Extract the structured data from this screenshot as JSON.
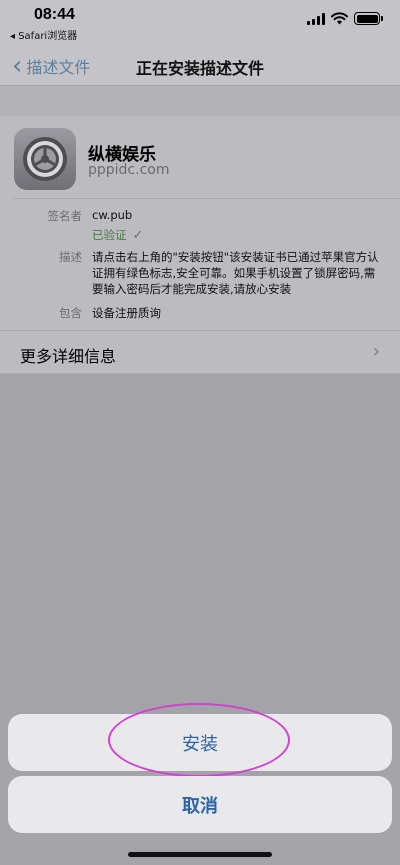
{
  "status_bar": {
    "time": "08:44",
    "back_app": "◂ Safari浏览器",
    "icons": [
      "signal-icon",
      "wifi-icon",
      "battery-icon"
    ]
  },
  "nav": {
    "back_label": "描述文件",
    "title": "正在安装描述文件"
  },
  "profile": {
    "icon": "gear-icon",
    "name": "纵横娱乐",
    "domain": "pppidc.com",
    "signer_label": "签名者",
    "signer_value": "cw.pub",
    "verified_label": "已验证",
    "description_label": "描述",
    "description_value": "请点击右上角的\"安装按钮\"该安装证书已通过苹果官方认证拥有绿色标志,安全可靠。如果手机设置了锁屏密码,需要输入密码后才能完成安装,请放心安装",
    "contains_label": "包含",
    "contains_value": "设备注册质询"
  },
  "more_details": {
    "label": "更多详细信息"
  },
  "action_sheet": {
    "install_label": "安装",
    "cancel_label": "取消"
  },
  "colors": {
    "accent_blue": "#2b62a8",
    "verified_green": "#4b7a4a",
    "highlight_magenta": "#d23fd6",
    "overlay_gray": "#a3a3a8"
  }
}
